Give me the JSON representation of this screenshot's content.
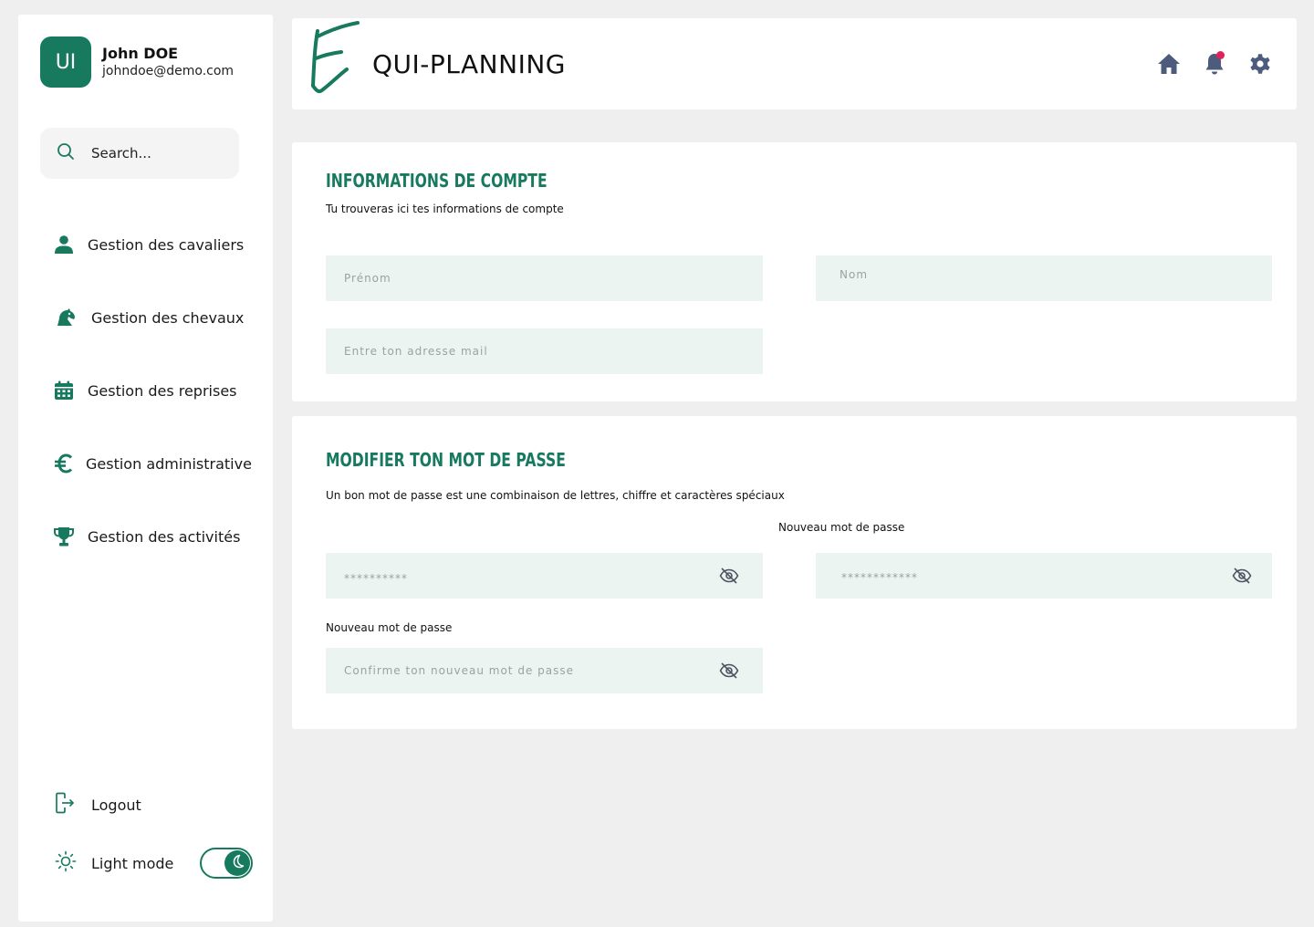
{
  "profile": {
    "initials": "UI",
    "name": "John DOE",
    "email": "johndoe@demo.com"
  },
  "search": {
    "placeholder": "Search..."
  },
  "nav": [
    {
      "label": "Gestion des cavaliers",
      "icon": "user-icon"
    },
    {
      "label": "Gestion des chevaux",
      "icon": "horse-icon"
    },
    {
      "label": "Gestion des reprises",
      "icon": "calendar-icon"
    },
    {
      "label": "Gestion administrative",
      "icon": "euro-icon"
    },
    {
      "label": "Gestion des activités",
      "icon": "trophy-icon"
    }
  ],
  "footer": {
    "logout_label": "Logout",
    "light_mode_label": "Light mode",
    "dark_mode_enabled": true
  },
  "header": {
    "logo_text": "QUI-PLANNING",
    "logo_letter": "E",
    "icons": [
      "home-icon",
      "bell-icon",
      "settings-icon"
    ],
    "has_notification": true
  },
  "account": {
    "title": "Informations de compte",
    "subtitle": "Tu trouveras ici tes informations de compte",
    "firstname_placeholder": "Prénom",
    "lastname_placeholder": "Nom",
    "email_placeholder": "Entre ton adresse mail"
  },
  "password": {
    "title": "Modifier ton mot de passe",
    "subtitle": "Un bon mot de passe est une combinaison de lettres, chiffre et caractères spéciaux",
    "current_value": "**********",
    "new_label": "Nouveau mot de passe",
    "new_value": "************",
    "confirm_label": "Nouveau mot de passe",
    "confirm_placeholder": "Confirme ton nouveau mot de passe"
  },
  "colors": {
    "accent": "#177a5f",
    "field_bg": "#ecf4f1",
    "page_bg": "#efefef",
    "notification": "#e0215a",
    "header_icons": "#4d5b7c"
  }
}
